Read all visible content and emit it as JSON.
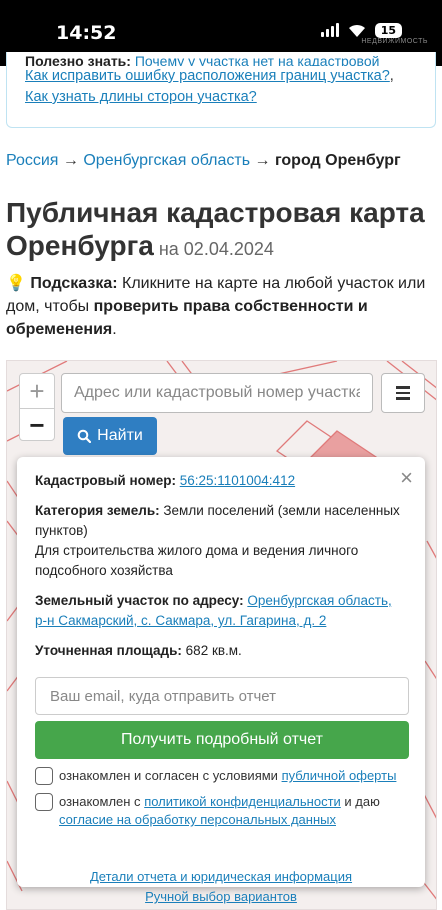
{
  "status": {
    "time": "14:52",
    "battery": "15",
    "watermark": "НЕДВИЖИМОСТЬ"
  },
  "help": {
    "cut_label": "Полезно знать:",
    "cut_link": "Почему у участка нет на кадастровой карте?",
    "link1": "Как исправить ошибку расположения границ участка?",
    "sep": ", ",
    "link2": "Как узнать длины сторон участка?"
  },
  "breadcrumb": {
    "item1": "Россия",
    "arrow": " → ",
    "item2": "Оренбургская область",
    "current": "город Оренбург"
  },
  "page": {
    "title": "Публичная кадастровая карта Оренбурга",
    "date_prefix": " на ",
    "date": "02.04.2024"
  },
  "hint": {
    "bulb": "💡",
    "label": "Подсказка:",
    "text1": " Кликните на карте на любой участок или дом, чтобы ",
    "bold": "проверить права собственности и обременения",
    "end": "."
  },
  "map": {
    "zoom_in": "+",
    "zoom_out": "−",
    "search_placeholder": "Адрес или кадастровый номер участка",
    "find_label": "Найти"
  },
  "popup": {
    "close": "×",
    "cadastral_label": "Кадастровый номер:",
    "cadastral_value": "56:25:1101004:412",
    "category_label": "Категория земель:",
    "category_value": " Земли поселений (земли населенных пунктов)",
    "usage": "Для строительства жилого дома и ведения личного подсобного хозяйства",
    "address_label": "Земельный участок по адресу:",
    "address_value": "Оренбургская область, р-н Сакмарский, с. Сакмара, ул. Гагарина, д. 2",
    "area_label": "Уточненная площадь:",
    "area_value": " 682 кв.м.",
    "email_placeholder": "Ваш email, куда отправить отчет",
    "get_report": "Получить подробный отчет",
    "agree1_text": "ознакомлен и согласен с условиями ",
    "agree1_link": "публичной оферты",
    "agree2_text": "ознакомлен с ",
    "agree2_link": "политикой конфиденциальности",
    "agree2_mid": " и даю ",
    "agree2_link2": "согласие на обработку персональных данных",
    "details_link": "Детали отчета и юридическая информация",
    "manual_link": "Ручной выбор вариантов"
  },
  "colors": {
    "link": "#1a7fba",
    "find_button": "#2f7ec2",
    "report_button": "#46a64b",
    "parcel_line": "#e07a7a"
  }
}
